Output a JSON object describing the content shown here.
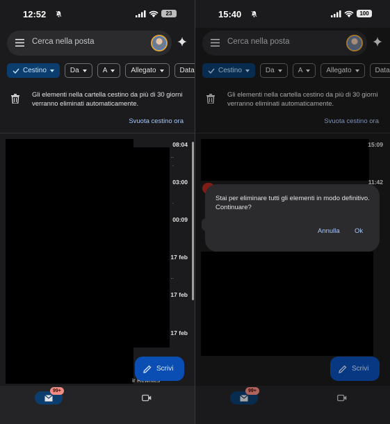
{
  "screens": [
    {
      "status": {
        "time": "12:52",
        "battery": "23"
      },
      "search": {
        "placeholder": "Cerca nella posta"
      },
      "chips": [
        "Cestino",
        "Da",
        "A",
        "Allegato",
        "Data"
      ],
      "notice": {
        "text": "Gli elementi nella cartella cestino da più di 30 giorni verranno eliminati automaticamente.",
        "action": "Svuota cestino ora"
      },
      "times": [
        "08:04",
        "03:00",
        "00:09",
        "17 feb",
        "17 feb",
        "17 feb"
      ],
      "fragment": "ir Rewrites",
      "compose": "Scrivi",
      "nav": {
        "mail_badge": "99+"
      }
    },
    {
      "status": {
        "time": "15:40",
        "battery": "100"
      },
      "search": {
        "placeholder": "Cerca nella posta"
      },
      "chips": [
        "Cestino",
        "Da",
        "A",
        "Allegato",
        "Data"
      ],
      "notice": {
        "text": "Gli elementi nella cartella cestino da più di 30 giorni verranno eliminati automaticamente.",
        "action": "Svuota cestino ora"
      },
      "times": [
        "15:09",
        "11:42"
      ],
      "dialog": {
        "message": "Stai per eliminare tutti gli elementi in modo definitivo. Continuare?",
        "cancel": "Annulla",
        "ok": "Ok"
      },
      "compose": "Scrivi",
      "nav": {
        "mail_badge": "99+"
      }
    }
  ],
  "colors": {
    "background": "#1b1b1d",
    "accent_chip": "#0b3e6e",
    "link": "#a8c7fa",
    "compose": "#0b4eb3",
    "badge": "#f28b82"
  }
}
